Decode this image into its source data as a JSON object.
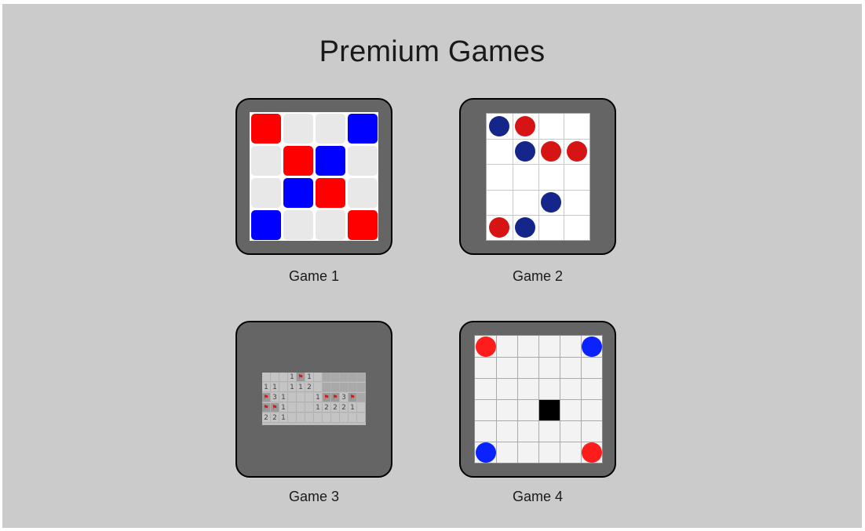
{
  "page": {
    "title": "Premium Games",
    "background": "#cbcbcb"
  },
  "games": [
    {
      "label": "Game 1",
      "thumbnail": {
        "kind": "tile-grid",
        "rows": 4,
        "cols": 4,
        "tiles": [
          [
            "red",
            "empty",
            "empty",
            "blue"
          ],
          [
            "empty",
            "red",
            "blue",
            "empty"
          ],
          [
            "empty",
            "blue",
            "red",
            "empty"
          ],
          [
            "blue",
            "empty",
            "empty",
            "red"
          ]
        ]
      }
    },
    {
      "label": "Game 2",
      "thumbnail": {
        "kind": "dot-grid",
        "rows": 5,
        "cols": 4,
        "dots": [
          {
            "row": 0,
            "col": 0,
            "color": "navy"
          },
          {
            "row": 0,
            "col": 1,
            "color": "red"
          },
          {
            "row": 1,
            "col": 1,
            "color": "navy"
          },
          {
            "row": 1,
            "col": 2,
            "color": "red"
          },
          {
            "row": 1,
            "col": 3,
            "color": "red"
          },
          {
            "row": 3,
            "col": 2,
            "color": "navy"
          },
          {
            "row": 4,
            "col": 0,
            "color": "red"
          },
          {
            "row": 4,
            "col": 1,
            "color": "navy"
          }
        ]
      }
    },
    {
      "label": "Game 3",
      "thumbnail": {
        "kind": "minesweeper",
        "rows": 5,
        "cols": 12,
        "grid": [
          [
            "o",
            "o",
            "o",
            "1",
            "F",
            "1",
            "o",
            "h",
            "h",
            "h",
            "h",
            "h"
          ],
          [
            "1",
            "1",
            "o",
            "1",
            "1",
            "2",
            "o",
            "h",
            "h",
            "h",
            "h",
            "h"
          ],
          [
            "F",
            "3",
            "1",
            "o",
            "o",
            "o",
            "1",
            "F",
            "F",
            "3",
            "F",
            "h"
          ],
          [
            "F",
            "F",
            "1",
            "o",
            "o",
            "o",
            "1",
            "2",
            "2",
            "2",
            "1",
            "o"
          ],
          [
            "2",
            "2",
            "1",
            "o",
            "o",
            "o",
            "o",
            "o",
            "o",
            "o",
            "o",
            "o"
          ]
        ]
      }
    },
    {
      "label": "Game 4",
      "thumbnail": {
        "kind": "corner-grid",
        "rows": 6,
        "cols": 6,
        "pieces": [
          {
            "row": 0,
            "col": 0,
            "color": "red"
          },
          {
            "row": 0,
            "col": 5,
            "color": "blue"
          },
          {
            "row": 5,
            "col": 0,
            "color": "blue"
          },
          {
            "row": 5,
            "col": 5,
            "color": "red"
          }
        ],
        "blocked": [
          {
            "row": 3,
            "col": 3
          }
        ]
      }
    }
  ],
  "colors": {
    "card": "#656565",
    "tile_red": "#ff0000",
    "tile_blue": "#0000ff",
    "tile_empty": "#e8e8e8",
    "dot_red": "#d71414",
    "dot_navy": "#14268a",
    "piece_red": "#ff1c1c",
    "piece_blue": "#0a22ff",
    "blocked": "#000000"
  }
}
